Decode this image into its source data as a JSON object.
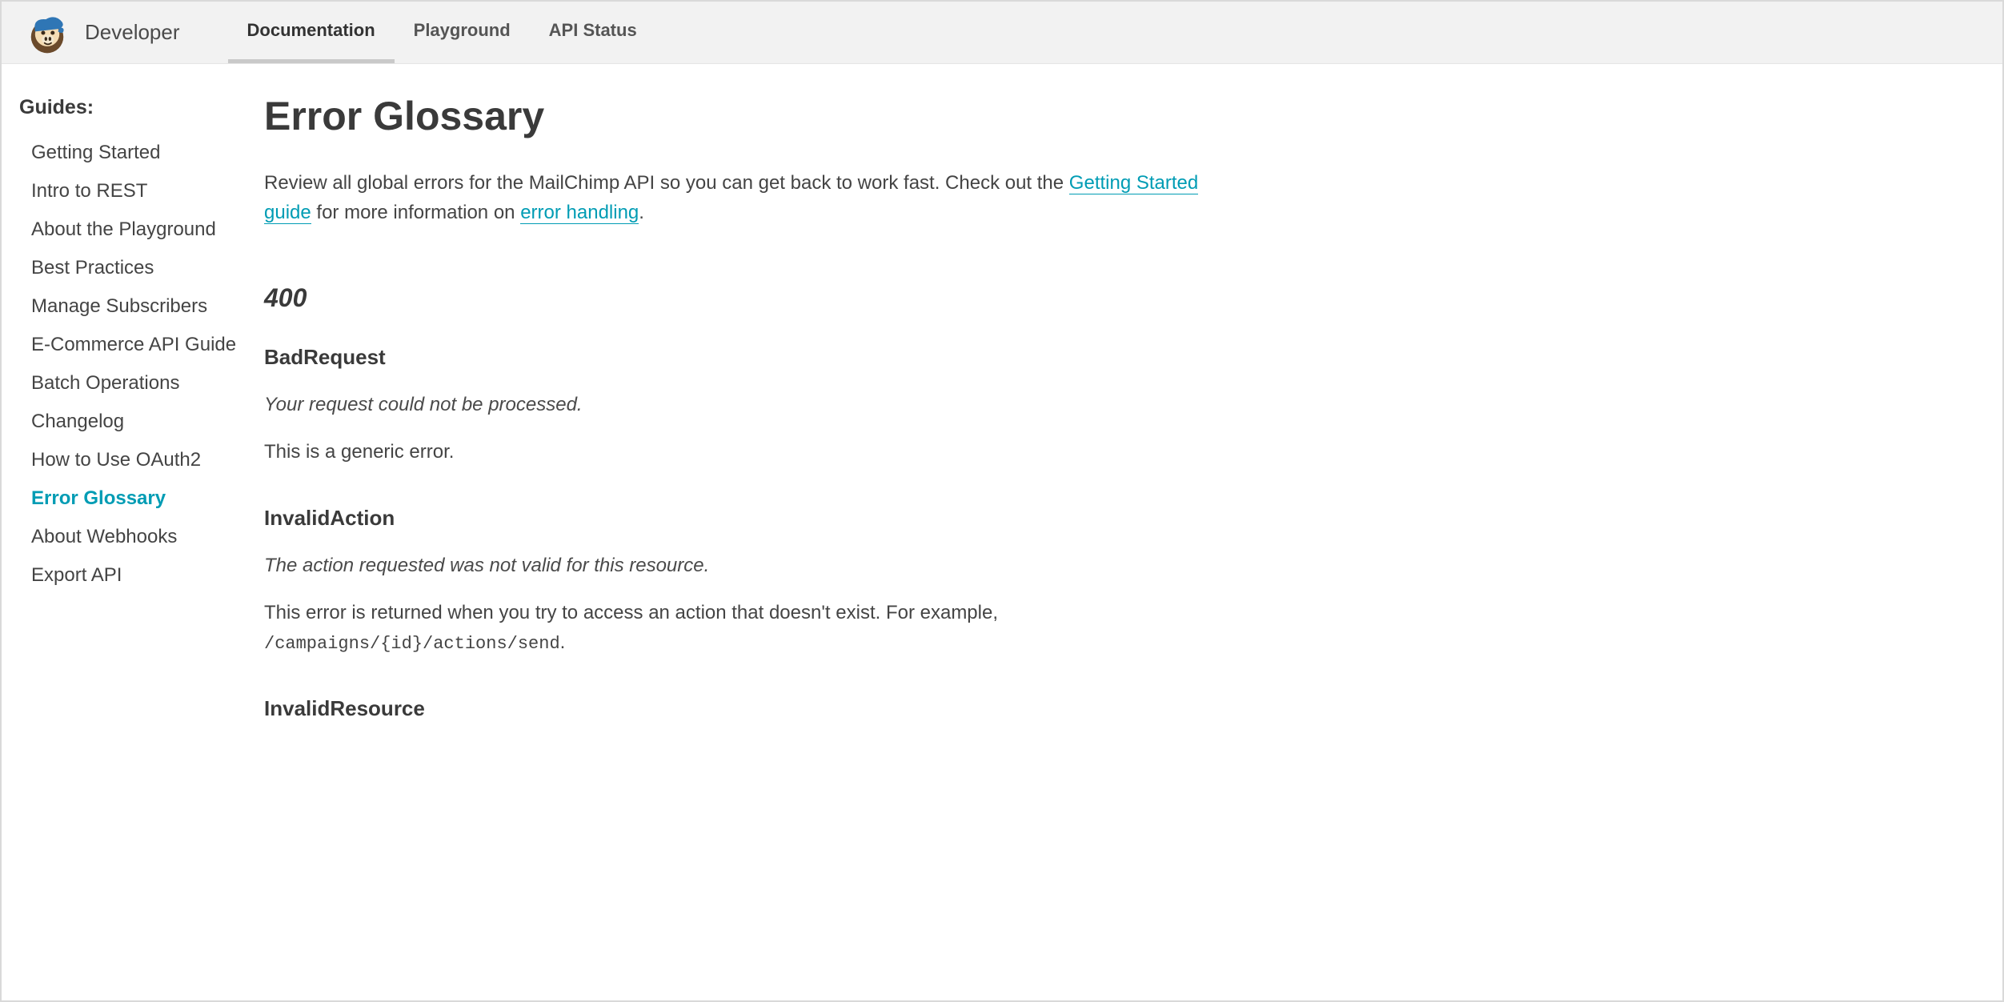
{
  "header": {
    "brand": "Developer",
    "nav": [
      {
        "label": "Documentation",
        "active": true
      },
      {
        "label": "Playground",
        "active": false
      },
      {
        "label": "API Status",
        "active": false
      }
    ]
  },
  "sidebar": {
    "heading": "Guides:",
    "items": [
      {
        "label": "Getting Started",
        "active": false
      },
      {
        "label": "Intro to REST",
        "active": false
      },
      {
        "label": "About the Playground",
        "active": false
      },
      {
        "label": "Best Practices",
        "active": false
      },
      {
        "label": "Manage Subscribers",
        "active": false
      },
      {
        "label": "E-Commerce API Guide",
        "active": false
      },
      {
        "label": "Batch Operations",
        "active": false
      },
      {
        "label": "Changelog",
        "active": false
      },
      {
        "label": "How to Use OAuth2",
        "active": false
      },
      {
        "label": "Error Glossary",
        "active": true
      },
      {
        "label": "About Webhooks",
        "active": false
      },
      {
        "label": "Export API",
        "active": false
      }
    ]
  },
  "content": {
    "title": "Error Glossary",
    "intro_pre": "Review all global errors for the MailChimp API so you can get back to work fast. Check out the ",
    "intro_link1": "Getting Started guide",
    "intro_mid": " for more information on ",
    "intro_link2": "error handling",
    "intro_post": ".",
    "status_code": "400",
    "errors": [
      {
        "name": "BadRequest",
        "summary": "Your request could not be processed.",
        "desc": "This is a generic error.",
        "code": ""
      },
      {
        "name": "InvalidAction",
        "summary": "The action requested was not valid for this resource.",
        "desc": "This error is returned when you try to access an action that doesn't exist. For example, ",
        "code": "/campaigns/{id}/actions/send"
      },
      {
        "name": "InvalidResource",
        "summary": "",
        "desc": "",
        "code": ""
      }
    ]
  }
}
